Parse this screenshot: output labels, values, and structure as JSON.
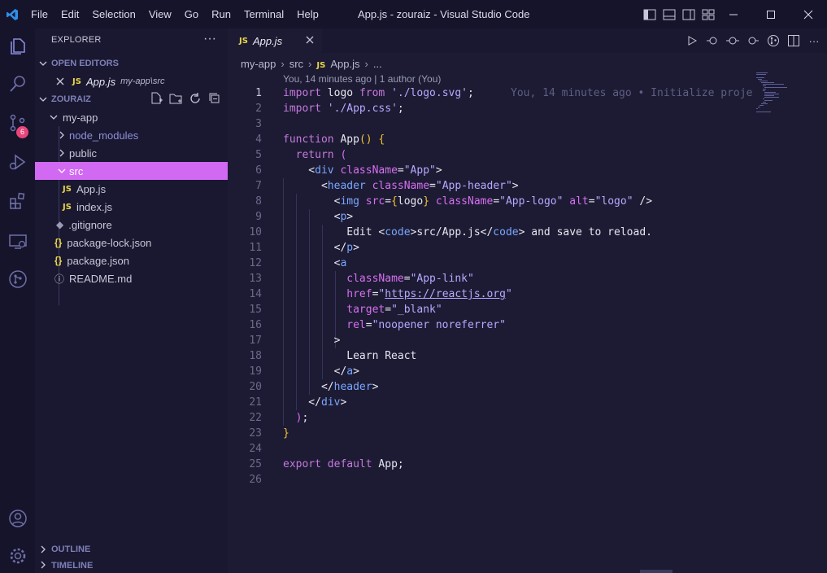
{
  "titlebar": {
    "menu": [
      "File",
      "Edit",
      "Selection",
      "View",
      "Go",
      "Run",
      "Terminal",
      "Help"
    ],
    "title": "App.js - zouraiz - Visual Studio Code"
  },
  "activity": {
    "scm_badge": "6"
  },
  "sidebar": {
    "header": "EXPLORER",
    "open_editors_label": "OPEN EDITORS",
    "open_editor": {
      "name": "App.js",
      "path": "my-app\\src"
    },
    "workspace_label": "ZOURAIZ",
    "tree": [
      {
        "name": "my-app",
        "type": "folder"
      },
      {
        "name": "node_modules",
        "type": "folder"
      },
      {
        "name": "public",
        "type": "folder"
      },
      {
        "name": "src",
        "type": "folder"
      },
      {
        "name": "App.js",
        "type": "js"
      },
      {
        "name": "index.js",
        "type": "js"
      },
      {
        "name": ".gitignore",
        "type": "git"
      },
      {
        "name": "package-lock.json",
        "type": "json"
      },
      {
        "name": "package.json",
        "type": "json"
      },
      {
        "name": "README.md",
        "type": "info"
      }
    ],
    "outline_label": "OUTLINE",
    "timeline_label": "TIMELINE"
  },
  "editor": {
    "tab_name": "App.js",
    "breadcrumb": [
      "my-app",
      "src",
      "App.js",
      "..."
    ],
    "codelens": "You, 14 minutes ago | 1 author (You)",
    "blame": "You, 14 minutes ago • Initialize proje",
    "line_numbers": [
      "1",
      "2",
      "3",
      "4",
      "5",
      "6",
      "7",
      "8",
      "9",
      "10",
      "11",
      "12",
      "13",
      "14",
      "15",
      "16",
      "17",
      "18",
      "19",
      "20",
      "21",
      "22",
      "23",
      "24",
      "25",
      "26"
    ]
  },
  "colors": {
    "accent": "#d269f3",
    "keyword": "#c678dd",
    "string": "#b7a9ff",
    "tag": "#7aa6ff",
    "badge": "#e8457a"
  }
}
